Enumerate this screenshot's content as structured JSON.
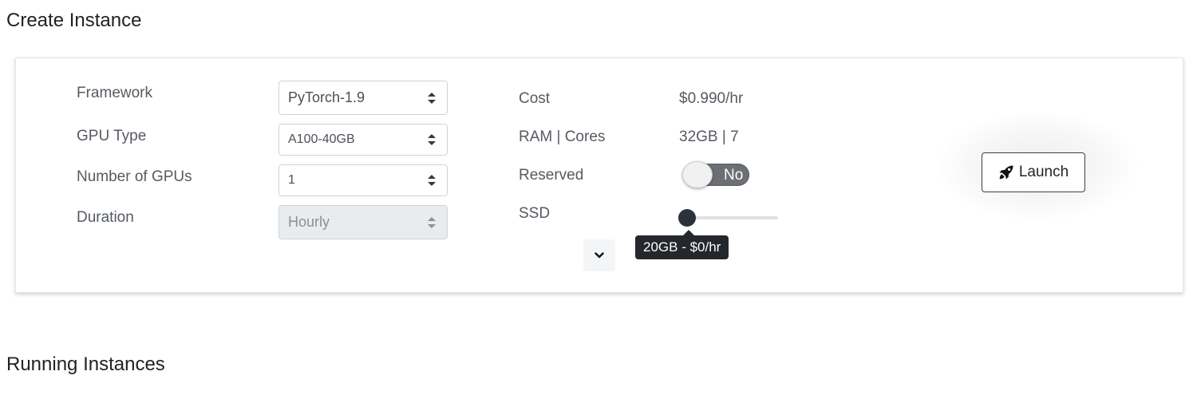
{
  "sections": {
    "create_title": "Create Instance",
    "running_title": "Running Instances"
  },
  "form": {
    "framework": {
      "label": "Framework",
      "value": "PyTorch-1.9"
    },
    "gpu_type": {
      "label": "GPU Type",
      "value": "A100-40GB"
    },
    "num_gpus": {
      "label": "Number of GPUs",
      "value": "1"
    },
    "duration": {
      "label": "Duration",
      "value": "Hourly",
      "disabled": true
    }
  },
  "details": {
    "cost": {
      "label": "Cost",
      "value": "$0.990/hr"
    },
    "ram_cores": {
      "label": "RAM | Cores",
      "value": "32GB | 7"
    },
    "reserved": {
      "label": "Reserved",
      "toggle_text": "No",
      "checked": false
    },
    "ssd": {
      "label": "SSD",
      "tooltip": "20GB - $0/hr",
      "slider_level": 0
    }
  },
  "actions": {
    "launch_label": "Launch",
    "launch_icon": "rocket-icon",
    "expand_icon": "chevron-down-icon"
  },
  "colors": {
    "tooltip_bg": "#24282d",
    "toggle_off": "#6c6f73",
    "slider_handle": "#2b323b"
  }
}
